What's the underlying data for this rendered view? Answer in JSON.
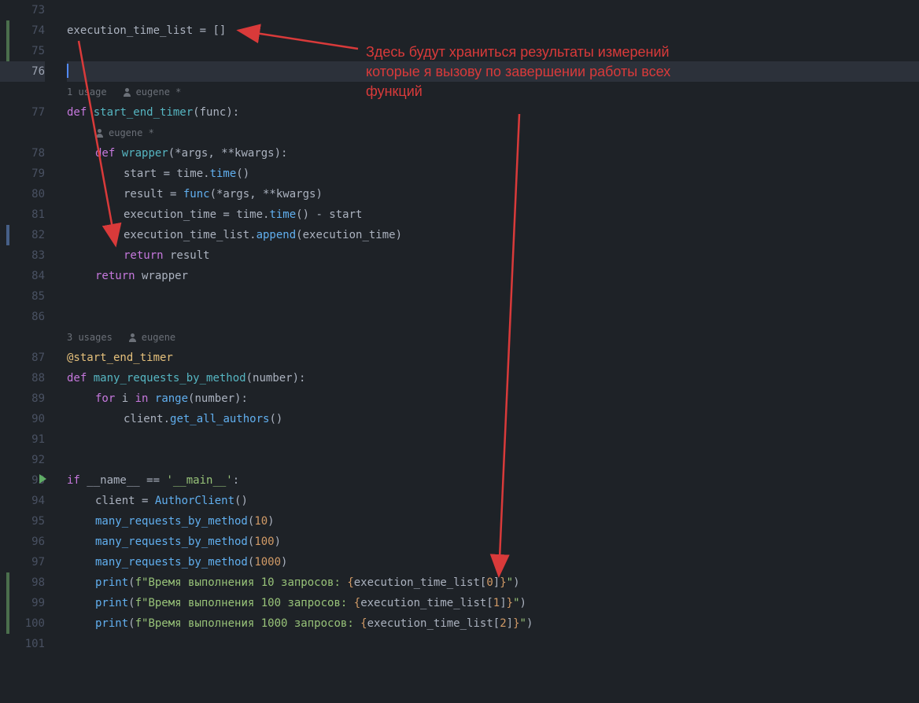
{
  "annotation": {
    "line1": "Здесь будут храниться результаты измерений",
    "line2": "которые я вызову по завершении работы всех",
    "line3": "функций"
  },
  "hints": {
    "usage1": "1 usage",
    "author1": "eugene *",
    "author2": "eugene *",
    "usage3": "3 usages",
    "author3": "eugene"
  },
  "lines": {
    "l73": "73",
    "l74": "74",
    "l75": "75",
    "l76": "76",
    "l77": "77",
    "l78": "78",
    "l79": "79",
    "l80": "80",
    "l81": "81",
    "l82": "82",
    "l83": "83",
    "l84": "84",
    "l85": "85",
    "l86": "86",
    "l87": "87",
    "l88": "88",
    "l89": "89",
    "l90": "90",
    "l91": "91",
    "l92": "92",
    "l93": "93",
    "l94": "94",
    "l95": "95",
    "l96": "96",
    "l97": "97",
    "l98": "98",
    "l99": "99",
    "l100": "100",
    "l101": "101"
  },
  "code": {
    "c74": {
      "a": "execution_time_list",
      "b": " = []"
    },
    "c77": {
      "a": "def",
      "b": " ",
      "c": "start_end_timer",
      "d": "(func):"
    },
    "c78": {
      "a": "def",
      "b": " ",
      "c": "wrapper",
      "d": "(*args, **kwargs):"
    },
    "c79": {
      "a": "start = time.",
      "b": "time",
      "c": "()"
    },
    "c80": {
      "a": "result = ",
      "b": "func",
      "c": "(*args, **kwargs)"
    },
    "c81": {
      "a": "execution_time = time.",
      "b": "time",
      "c": "() - start"
    },
    "c82": {
      "a": "execution_time_list.",
      "b": "append",
      "c": "(execution_time)"
    },
    "c83": {
      "a": "return",
      "b": " result"
    },
    "c84": {
      "a": "return",
      "b": " wrapper"
    },
    "c87": {
      "a": "@start_end_timer"
    },
    "c88": {
      "a": "def",
      "b": " ",
      "c": "many_requests_by_method",
      "d": "(number):"
    },
    "c89": {
      "a": "for",
      "b": " i ",
      "c": "in",
      "d": " ",
      "e": "range",
      "f": "(number):"
    },
    "c90": {
      "a": "client.",
      "b": "get_all_authors",
      "c": "()"
    },
    "c93": {
      "a": "if",
      "b": " __name__ == ",
      "c": "'__main__'",
      "d": ":"
    },
    "c94": {
      "a": "client = ",
      "b": "AuthorClient",
      "c": "()"
    },
    "c95": {
      "a": "many_requests_by_method",
      "b": "(",
      "c": "10",
      "d": ")"
    },
    "c96": {
      "a": "many_requests_by_method",
      "b": "(",
      "c": "100",
      "d": ")"
    },
    "c97": {
      "a": "many_requests_by_method",
      "b": "(",
      "c": "1000",
      "d": ")"
    },
    "c98": {
      "a": "print",
      "b": "(",
      "c": "f\"Время выполнения 10 запросов: ",
      "d": "{",
      "e": "execution_time_list[",
      "f": "0",
      "g": "]",
      "h": "}",
      "i": "\"",
      "j": ")"
    },
    "c99": {
      "a": "print",
      "b": "(",
      "c": "f\"Время выполнения 100 запросов: ",
      "d": "{",
      "e": "execution_time_list[",
      "f": "1",
      "g": "]",
      "h": "}",
      "i": "\"",
      "j": ")"
    },
    "c100": {
      "a": "print",
      "b": "(",
      "c": "f\"Время выполнения 1000 запросов: ",
      "d": "{",
      "e": "execution_time_list[",
      "f": "2",
      "g": "]",
      "h": "}",
      "i": "\"",
      "j": ")"
    }
  }
}
